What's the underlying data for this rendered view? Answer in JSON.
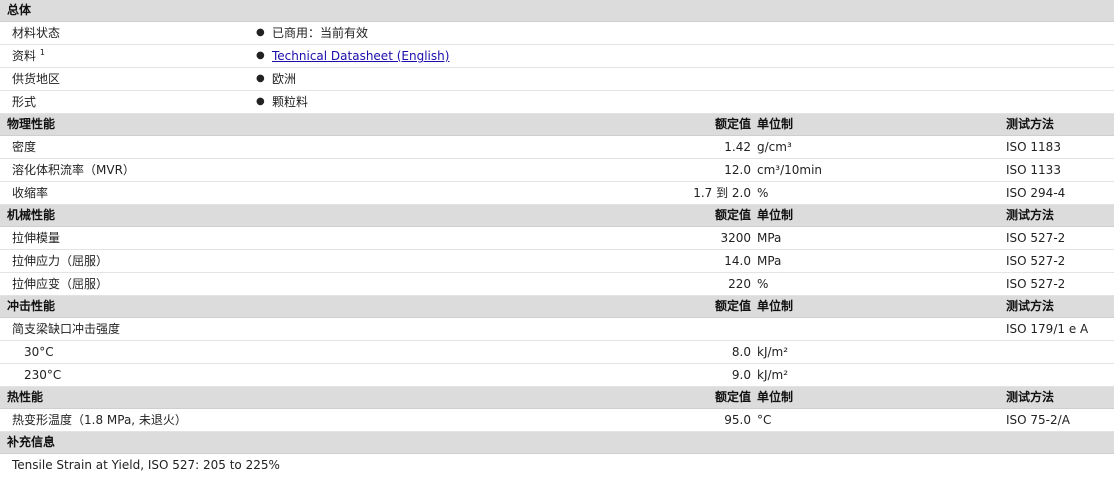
{
  "general": {
    "title": "总体",
    "rows": [
      {
        "label": "材料状态",
        "value": "已商用：当前有效",
        "link": false
      },
      {
        "label": "资料",
        "sup": "1",
        "value": "Technical Datasheet (English)",
        "link": true
      },
      {
        "label": "供货地区",
        "value": "欧洲",
        "link": false
      },
      {
        "label": "形式",
        "value": "颗粒料",
        "link": false
      }
    ]
  },
  "column_headers": {
    "value": "额定值",
    "unit": "单位制",
    "test": "测试方法"
  },
  "physical": {
    "title": "物理性能",
    "rows": [
      {
        "label": "密度",
        "value": "1.42",
        "unit": "g/cm³",
        "test": "ISO 1183"
      },
      {
        "label": "溶化体积流率（MVR）",
        "value": "12.0",
        "unit": "cm³/10min",
        "test": "ISO 1133"
      },
      {
        "label": "收缩率",
        "value": "1.7 到  2.0",
        "unit": "%",
        "test": "ISO 294-4"
      }
    ]
  },
  "mechanical": {
    "title": "机械性能",
    "rows": [
      {
        "label": "拉伸模量",
        "value": "3200",
        "unit": "MPa",
        "test": "ISO 527-2"
      },
      {
        "label": "拉伸应力（屈服）",
        "value": "14.0",
        "unit": "MPa",
        "test": "ISO 527-2"
      },
      {
        "label": "拉伸应变（屈服）",
        "value": "220",
        "unit": "%",
        "test": "ISO 527-2"
      }
    ]
  },
  "impact": {
    "title": "冲击性能",
    "rows": [
      {
        "label": "简支梁缺口冲击强度",
        "value": "",
        "unit": "",
        "test": "ISO 179/1 e A"
      },
      {
        "label": "30°C",
        "value": "8.0",
        "unit": "kJ/m²",
        "test": ""
      },
      {
        "label": "230°C",
        "value": "9.0",
        "unit": "kJ/m²",
        "test": ""
      }
    ]
  },
  "thermal": {
    "title": "热性能",
    "rows": [
      {
        "label": "热变形温度（1.8 MPa, 未退火）",
        "value": "95.0",
        "unit": "°C",
        "test": "ISO 75-2/A"
      }
    ]
  },
  "supplementary": {
    "title": "补充信息",
    "note": "Tensile Strain at Yield, ISO 527: 205 to 225%"
  }
}
